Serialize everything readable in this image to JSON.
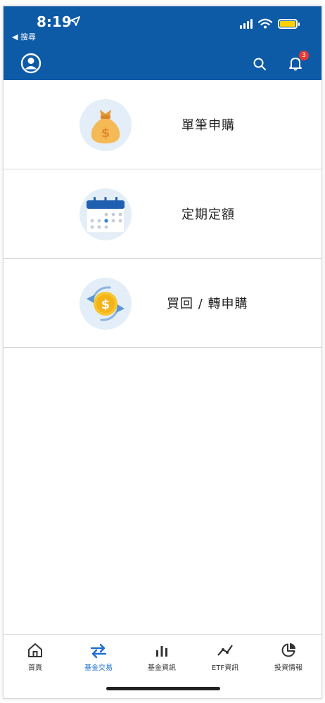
{
  "status_bar": {
    "time": "8:19",
    "back_label": "◀ 搜尋"
  },
  "header": {
    "notification_count": "3"
  },
  "menu": {
    "items": [
      {
        "label": "單筆申購",
        "icon": "money-bag-icon"
      },
      {
        "label": "定期定額",
        "icon": "calendar-icon"
      },
      {
        "label": "買回 / 轉申購",
        "icon": "coin-exchange-icon"
      }
    ]
  },
  "tab_bar": {
    "tabs": [
      {
        "label": "首頁",
        "icon": "home-icon",
        "active": false
      },
      {
        "label": "基金交易",
        "icon": "exchange-arrows-icon",
        "active": true
      },
      {
        "label": "基金資訊",
        "icon": "bar-chart-icon",
        "active": false
      },
      {
        "label": "ETF資訊",
        "icon": "line-chart-icon",
        "active": false
      },
      {
        "label": "投資情報",
        "icon": "pie-chart-icon",
        "active": false
      }
    ]
  },
  "colors": {
    "primary": "#0d5aa7",
    "active_tab": "#1d6fd1",
    "badge": "#e53935",
    "icon_bg": "#e3eef8",
    "coin": "#f6c02b",
    "bag": "#f5b955"
  }
}
